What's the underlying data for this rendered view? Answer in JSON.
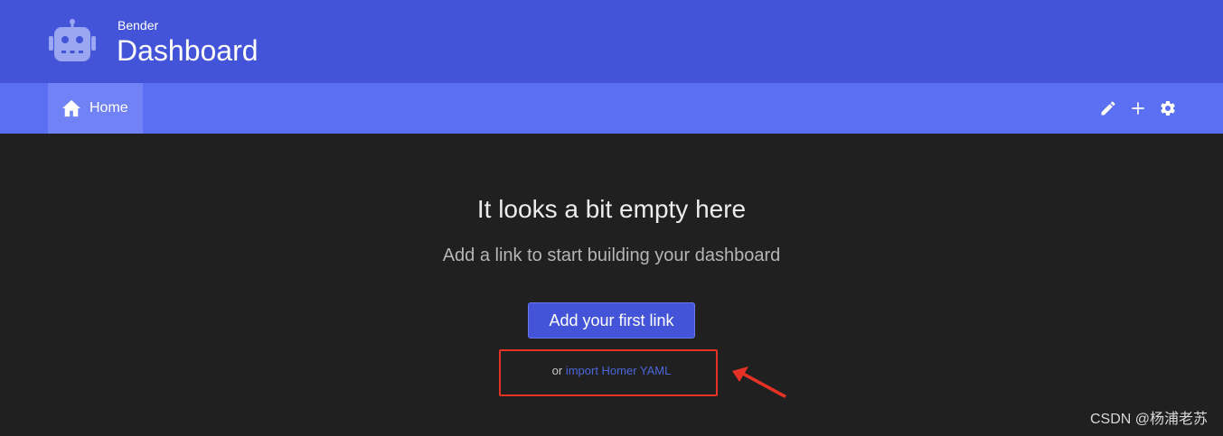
{
  "header": {
    "subtitle": "Bender",
    "title": "Dashboard",
    "logo_icon": "robot-icon",
    "colors": {
      "header_bg": "#4454d8",
      "navbar_bg": "#5a6ff2",
      "active_tab_bg": "#7082f5"
    }
  },
  "nav": {
    "items": [
      {
        "label": "Home",
        "icon": "home-icon",
        "active": true
      }
    ],
    "actions": [
      {
        "icon": "pencil-icon"
      },
      {
        "icon": "plus-icon"
      },
      {
        "icon": "gear-icon"
      }
    ]
  },
  "main": {
    "empty_title": "It looks a bit empty here",
    "empty_subtitle": "Add a link to start building your dashboard",
    "add_button_label": "Add your first link",
    "import_prefix": "or",
    "import_link_label": "import Homer YAML",
    "annotation_color": "#e53225"
  },
  "watermark": "CSDN @杨浦老苏"
}
